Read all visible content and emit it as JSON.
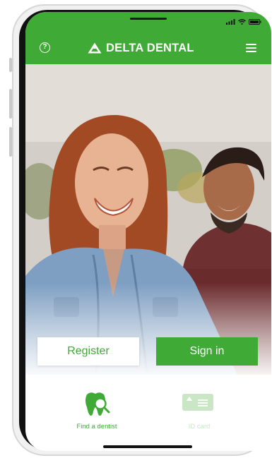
{
  "colors": {
    "brand_green": "#3faa35",
    "header_text": "#ffffff",
    "id_card_muted": "#c9e6c5"
  },
  "header": {
    "help_icon": "help-circle-icon",
    "help_glyph": "?",
    "brand_name": "DELTA DENTAL",
    "logo_icon": "delta-triangle-icon",
    "menu_icon": "hamburger-menu-icon"
  },
  "status_bar": {
    "icons": [
      "signal-icon",
      "wifi-icon",
      "battery-icon"
    ]
  },
  "hero": {
    "image": "photo of two smiling people (woman and man) outdoors"
  },
  "actions": {
    "register_label": "Register",
    "sign_in_label": "Sign in"
  },
  "shortcuts": [
    {
      "label": "Find a dentist",
      "icon": "tooth-search-icon"
    },
    {
      "label": "ID card",
      "icon": "id-card-icon"
    }
  ]
}
